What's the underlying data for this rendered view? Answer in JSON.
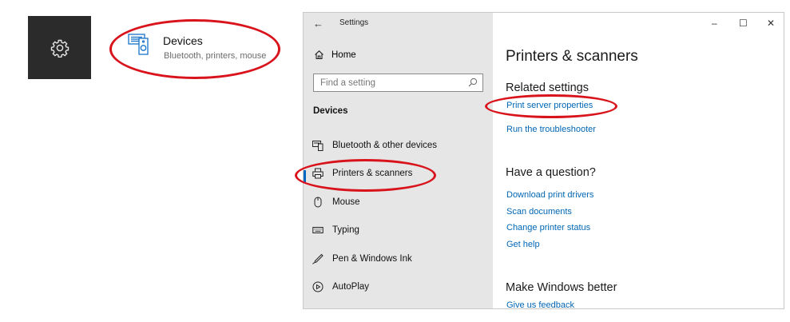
{
  "tile": {
    "icon": "gear-icon"
  },
  "devices": {
    "icon": "devices-icon",
    "title": "Devices",
    "subtitle": "Bluetooth, printers, mouse"
  },
  "window": {
    "title": "Settings",
    "back_icon": "back-arrow-icon",
    "controls": {
      "minimize": "–",
      "maximize": "☐",
      "close": "✕"
    }
  },
  "nav": {
    "home": "Home",
    "search_placeholder": "Find a setting",
    "section": "Devices",
    "items": [
      {
        "label": "Bluetooth & other devices",
        "icon": "bluetooth-devices-icon"
      },
      {
        "label": "Printers & scanners",
        "icon": "printer-icon",
        "selected": true
      },
      {
        "label": "Mouse",
        "icon": "mouse-icon"
      },
      {
        "label": "Typing",
        "icon": "keyboard-icon"
      },
      {
        "label": "Pen & Windows Ink",
        "icon": "pen-icon"
      },
      {
        "label": "AutoPlay",
        "icon": "autoplay-icon"
      }
    ]
  },
  "content": {
    "title": "Printers & scanners",
    "related_heading": "Related settings",
    "related_links": [
      "Print server properties",
      "Run the troubleshooter"
    ],
    "question_heading": "Have a question?",
    "question_links": [
      "Download print drivers",
      "Scan documents",
      "Change printer status",
      "Get help"
    ],
    "better_heading": "Make Windows better",
    "better_links": [
      "Give us feedback"
    ]
  },
  "colors": {
    "accent": "#0066b4",
    "callout": "#d9131b",
    "nav_bg": "#e6e6e6",
    "tile_bg": "#2b2b2b"
  }
}
